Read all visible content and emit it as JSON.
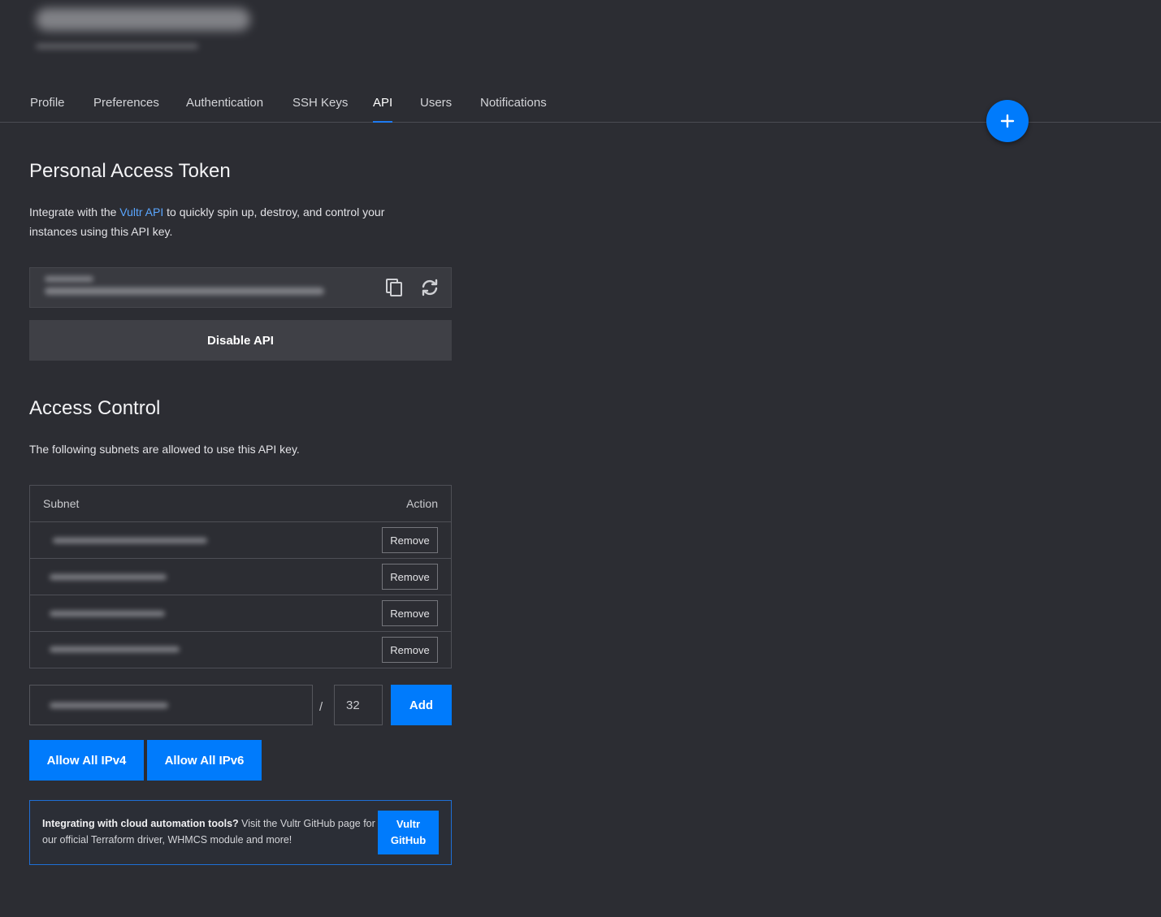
{
  "tabs": [
    {
      "label": "Profile"
    },
    {
      "label": "Preferences"
    },
    {
      "label": "Authentication"
    },
    {
      "label": "SSH Keys"
    },
    {
      "label": "API",
      "active": true
    },
    {
      "label": "Users"
    },
    {
      "label": "Notifications"
    }
  ],
  "fab": {
    "icon": "plus-icon",
    "label": "+"
  },
  "token": {
    "title": "Personal Access Token",
    "desc_pre": "Integrate with the ",
    "desc_link": "Vultr API",
    "desc_post": " to quickly spin up, destroy, and control your instances using this API key.",
    "copy_icon": "copy-icon",
    "regenerate_icon": "refresh-icon",
    "disable_label": "Disable API"
  },
  "access": {
    "title": "Access Control",
    "desc": "The following subnets are allowed to use this API key.",
    "col_subnet": "Subnet",
    "col_action": "Action",
    "rows": [
      {
        "remove_label": "Remove"
      },
      {
        "remove_label": "Remove"
      },
      {
        "remove_label": "Remove"
      },
      {
        "remove_label": "Remove"
      }
    ],
    "mask_value": "32",
    "separator": "/",
    "add_label": "Add",
    "allow_ipv4_label": "Allow All IPv4",
    "allow_ipv6_label": "Allow All IPv6"
  },
  "info": {
    "bold": "Integrating with cloud automation tools?",
    "text": " Visit the Vultr GitHub page for our official Terraform driver, WHMCS module and more!",
    "button_label": "Vultr\nGitHub"
  },
  "colors": {
    "accent": "#007bfc",
    "link": "#5aa6ff",
    "background": "#2c2d33"
  }
}
